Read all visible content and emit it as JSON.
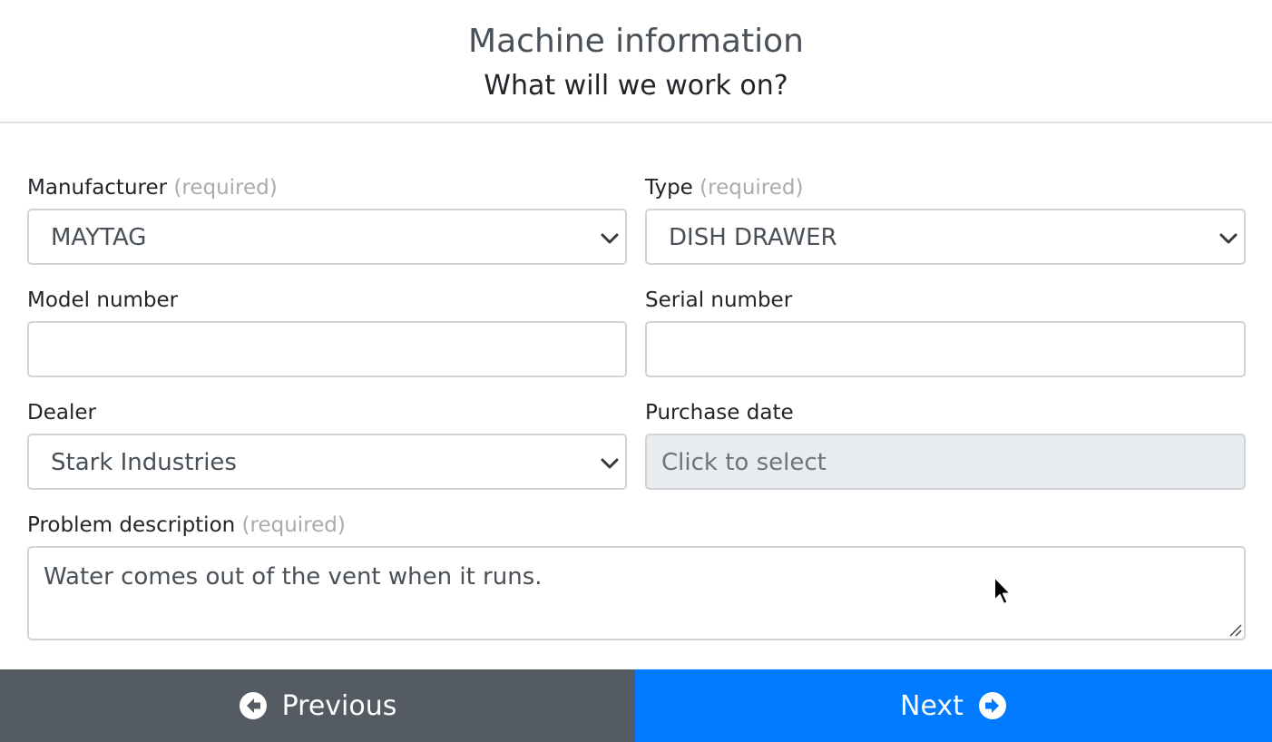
{
  "header": {
    "title": "Machine information",
    "subtitle": "What will we work on?"
  },
  "form": {
    "manufacturer": {
      "label": "Manufacturer",
      "required_text": "(required)",
      "value": "MAYTAG"
    },
    "type": {
      "label": "Type",
      "required_text": "(required)",
      "value": "DISH DRAWER"
    },
    "model_number": {
      "label": "Model number",
      "value": ""
    },
    "serial_number": {
      "label": "Serial number",
      "value": ""
    },
    "dealer": {
      "label": "Dealer",
      "value": "Stark Industries"
    },
    "purchase_date": {
      "label": "Purchase date",
      "placeholder": "Click to select"
    },
    "problem_description": {
      "label": "Problem description",
      "required_text": "(required)",
      "value": "Water comes out of the vent when it runs."
    }
  },
  "footer": {
    "previous_label": "Previous",
    "next_label": "Next"
  },
  "icons": {
    "previous": "arrow-circle-left-icon",
    "next": "arrow-circle-right-icon",
    "dropdown": "chevron-down-icon"
  },
  "colors": {
    "previous_button": "#545b62",
    "next_button": "#007bff",
    "disabled_field": "#e9ecef"
  }
}
